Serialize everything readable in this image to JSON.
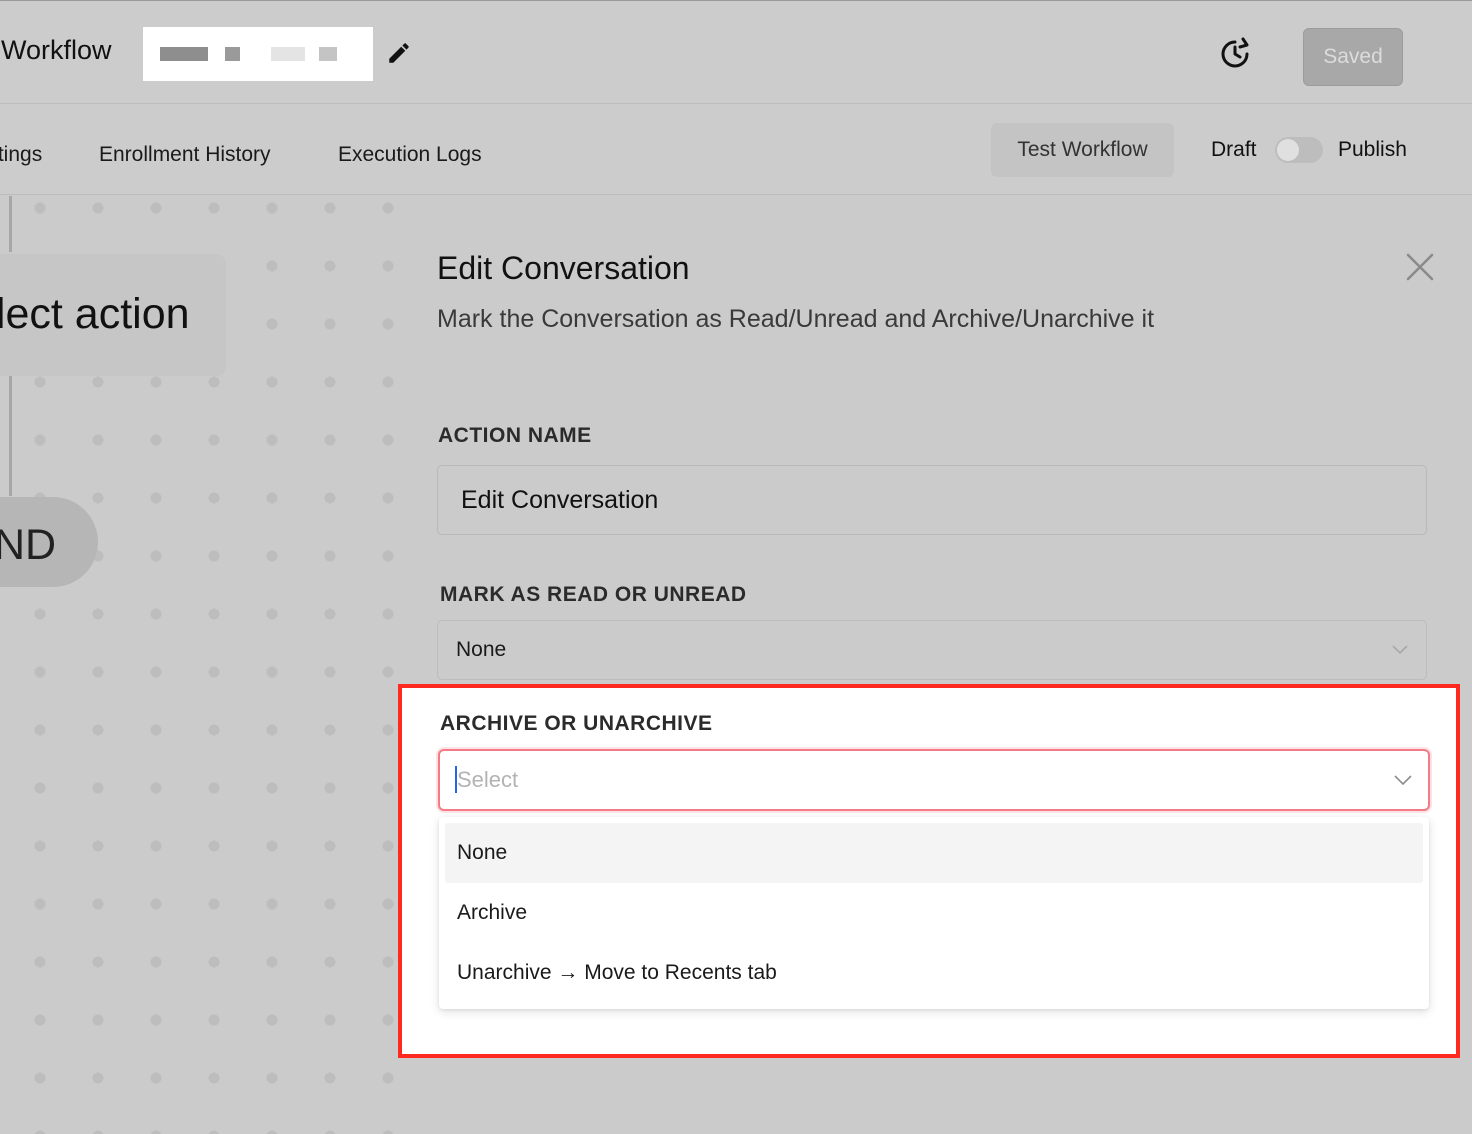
{
  "header": {
    "workflow_title": "/ Workflow",
    "save_label": "Saved"
  },
  "tabs": {
    "settings": "ttings",
    "enrollment_history": "Enrollment History",
    "execution_logs": "Execution Logs",
    "test_workflow": "Test Workflow",
    "draft": "Draft",
    "publish": "Publish"
  },
  "canvas": {
    "action_node": "elect action",
    "end_node": "ND"
  },
  "panel": {
    "title": "Edit Conversation",
    "subtitle": "Mark the Conversation as Read/Unread and Archive/Unarchive it",
    "action_name_label": "ACTION NAME",
    "action_name_value": "Edit Conversation",
    "read_label": "MARK AS READ OR UNREAD",
    "read_value": "None",
    "archive_label": "ARCHIVE OR UNARCHIVE",
    "archive_placeholder": "Select",
    "archive_options": [
      "None",
      "Archive",
      "Unarchive → Move to Recents tab"
    ]
  },
  "colors": {
    "highlight_border": "#ff2a1f",
    "focus_border": "#f47a84",
    "caret": "#2563eb"
  }
}
